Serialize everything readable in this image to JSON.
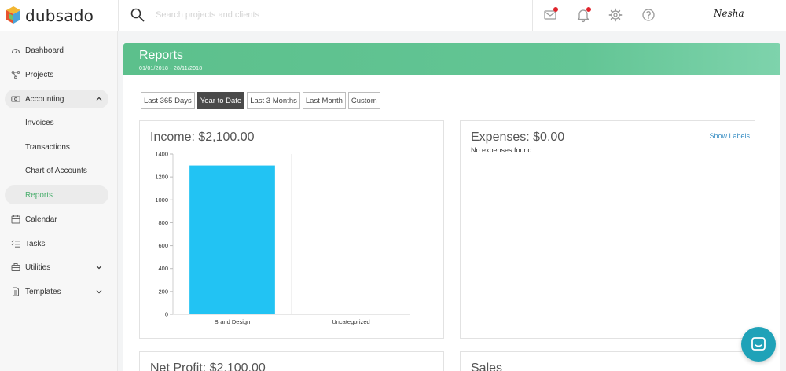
{
  "app": {
    "name": "dubsado"
  },
  "search": {
    "placeholder": "Search projects and clients"
  },
  "user": {
    "signature": "Nesha"
  },
  "sidebar": {
    "items": [
      {
        "label": "Dashboard"
      },
      {
        "label": "Projects"
      },
      {
        "label": "Accounting"
      },
      {
        "label": "Invoices"
      },
      {
        "label": "Transactions"
      },
      {
        "label": "Chart of Accounts"
      },
      {
        "label": "Reports"
      },
      {
        "label": "Calendar"
      },
      {
        "label": "Tasks"
      },
      {
        "label": "Utilities"
      },
      {
        "label": "Templates"
      }
    ]
  },
  "report": {
    "title": "Reports",
    "date_range": "01/01/2018 - 28/11/2018",
    "range_buttons": [
      "Last 365 Days",
      "Year to Date",
      "Last 3 Months",
      "Last Month",
      "Custom"
    ],
    "selected_range": "Year to Date"
  },
  "income": {
    "title": "Income: $2,100.00"
  },
  "expenses": {
    "title": "Expenses: $0.00",
    "empty_text": "No expenses found",
    "show_labels": "Show Labels"
  },
  "net_profit": {
    "title": "Net Profit: $2,100.00"
  },
  "sales": {
    "title": "Sales"
  },
  "colors": {
    "accent": "#5cc08c",
    "bar": "#22c3f3",
    "active_nav": "#4caf6f",
    "chat": "#1fa2b8"
  },
  "chart_data": {
    "type": "bar",
    "categories": [
      "Brand Design",
      "Uncategorized"
    ],
    "values": [
      1300,
      0
    ],
    "ylim": [
      0,
      1400
    ],
    "yticks": [
      0,
      200,
      400,
      600,
      800,
      1000,
      1200,
      1400
    ],
    "title": "Income: $2,100.00",
    "xlabel": "",
    "ylabel": ""
  }
}
